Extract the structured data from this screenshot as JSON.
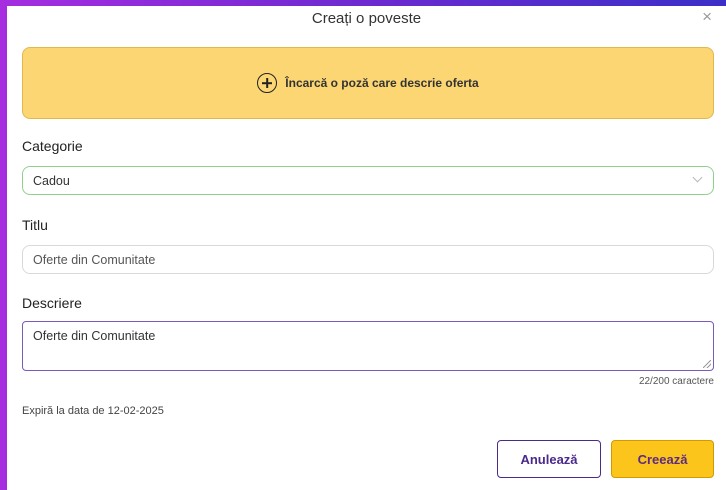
{
  "dialog": {
    "title": "Creați o poveste",
    "close_symbol": "×"
  },
  "upload": {
    "icon": "plus-circle-icon",
    "label": "Încarcă o poză care descrie oferta"
  },
  "category": {
    "label": "Categorie",
    "value": "Cadou",
    "icon": "chevron-down-icon"
  },
  "title_field": {
    "label": "Titlu",
    "value": "Oferte din Comunitate"
  },
  "description": {
    "label": "Descriere",
    "value": "Oferte din Comunitate",
    "counter": "22/200 caractere"
  },
  "expiry": "Expiră la data de 12-02-2025",
  "buttons": {
    "cancel": "Anulează",
    "create": "Creează"
  },
  "colors": {
    "upload_bg": "#fbd673",
    "create_bg": "#fcc51b",
    "accent_purple": "#4b2a8a",
    "select_border": "#8fd08f"
  }
}
